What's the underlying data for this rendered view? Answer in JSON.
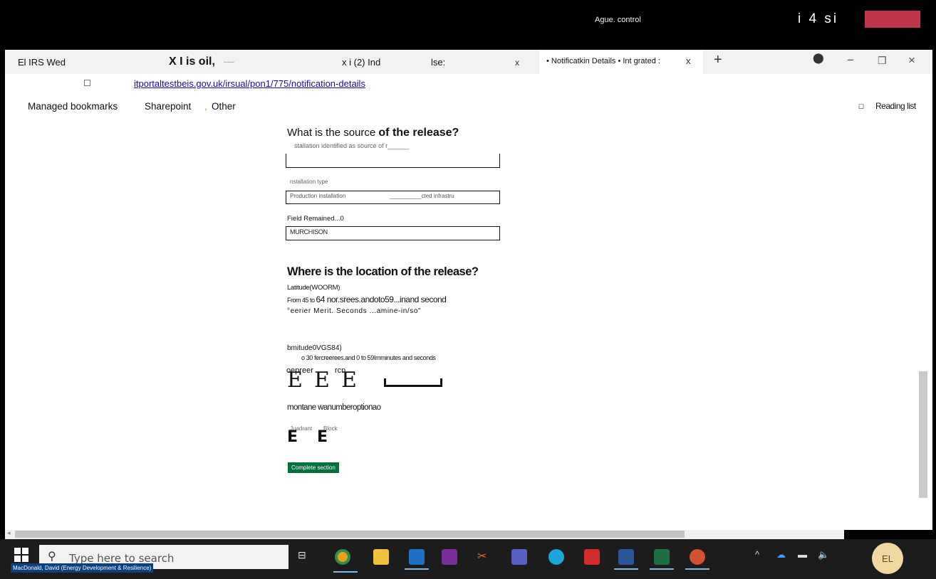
{
  "meeting_bar": {
    "title": "Ague. control",
    "stats": "i 4 si"
  },
  "tabs": [
    {
      "label": "El IRS Wed",
      "close": ""
    },
    {
      "label": "X I is oil,",
      "extra": "-----",
      "close": ""
    },
    {
      "label": "x i (2) Ind",
      "close": ""
    },
    {
      "label": "lse:",
      "close": "x"
    }
  ],
  "active_tab": {
    "label": "• Notificatkin Details • Int grated :",
    "close": "x"
  },
  "new_tab": "+",
  "window_controls": {
    "minimize": "−",
    "restore": "❐",
    "close": "×"
  },
  "address": {
    "url": "itportaltestbeis.gov.uk/irsual/pon1/775/notification-details"
  },
  "bookmarks": {
    "items": [
      "Managed bookmarks",
      "Sharepoint",
      ",",
      "Other"
    ],
    "reading_list": "Reading list"
  },
  "form": {
    "source_heading_a": "What is the source ",
    "source_heading_b": "of the release?",
    "installation_label": "stallation identified as source of r______",
    "installation_value": "",
    "installation_type_label": "nstallation type",
    "installation_type_value": "Production installation",
    "installation_type_value2": "__________cted infrastru",
    "field_label": "Field Remained...0",
    "field_value": "MURCHISON",
    "location_heading": "Where is the location of the release?",
    "latitude_label": "Latitude(WOORM)",
    "latitude_hint_a": "From 45 to ",
    "latitude_hint_b": "64 nor.srees.andoto59...inand second",
    "latitude_hint2": "°eerier Merit. Seconds ...amine-in/so\"",
    "longitude_label": "bmitude0VGS84)",
    "longitude_hint": "o 30 fercreerees.and 0 to 59Imminutes and seconds",
    "degree_label": "oepreer",
    "minute_label": "rcn",
    "e_glyphs": [
      "E",
      "E",
      "E"
    ],
    "montane": "montane wanumberoptionao",
    "quadrant_label": "Juadrant",
    "block_label": "Block",
    "quadrant_glyphs": [
      "E",
      "E"
    ],
    "complete_button": "Complete section"
  },
  "taskbar": {
    "search_placeholder": "Type here to search",
    "user_label": "MacDonald, David (Energy Development & Resilience)",
    "avatar_initials": "EL",
    "icons": [
      "task-view",
      "chrome",
      "file-explorer",
      "outlook",
      "onenote",
      "snipping-tool",
      "teams",
      "edge",
      "acrobat",
      "word",
      "excel",
      "powerpoint"
    ]
  },
  "colors": {
    "meeting_red": "#c1354a",
    "button_green": "#00703c",
    "link_blue": "#1a0dab",
    "taskbar": "#1c1c1c"
  }
}
